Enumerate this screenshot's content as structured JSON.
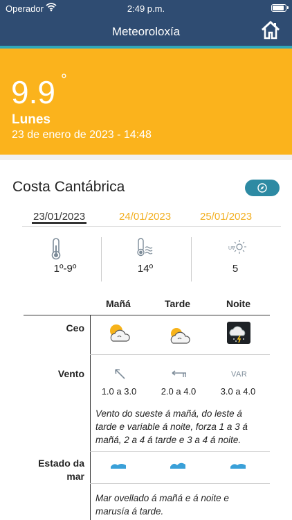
{
  "status_bar": {
    "carrier": "Operador",
    "time": "2:49 p.m."
  },
  "nav": {
    "title": "Meteoroloxía",
    "home_icon": "home-icon"
  },
  "current": {
    "temperature": "9.9",
    "degree_symbol": "°",
    "day": "Lunes",
    "datetime": "23 de enero de 2023 - 14:48"
  },
  "region": {
    "name": "Costa Cantábrica"
  },
  "tabs": [
    {
      "label": "23/01/2023",
      "active": true
    },
    {
      "label": "24/01/2023",
      "active": false
    },
    {
      "label": "25/01/2023",
      "active": false
    }
  ],
  "summary": {
    "temperature_range": "1º-9º",
    "sea_temperature": "14º",
    "uv_index": "5"
  },
  "columns": {
    "morning": "Mañá",
    "afternoon": "Tarde",
    "night": "Noite"
  },
  "rows": {
    "sky": {
      "label": "Ceo"
    },
    "wind": {
      "label": "Vento",
      "morning": "1.0 a 3.0",
      "afternoon": "2.0 a 4.0",
      "night": "3.0 a 4.0",
      "night_direction": "VAR",
      "description": "Vento do sueste á mañá, do leste á tarde e variable á noite, forza 1 a 3 á mañá, 2 a 4 á tarde e 3 a 4 á noite."
    },
    "sea": {
      "label_line1": "Estado da",
      "label_line2": "mar",
      "description": "Mar ovellado á mañá e á noite e marusía á tarde."
    }
  },
  "colors": {
    "header": "#2f4c72",
    "accent": "#fbb31c",
    "teal": "#2fa8b9",
    "date_tab": "#f2ae1e"
  }
}
